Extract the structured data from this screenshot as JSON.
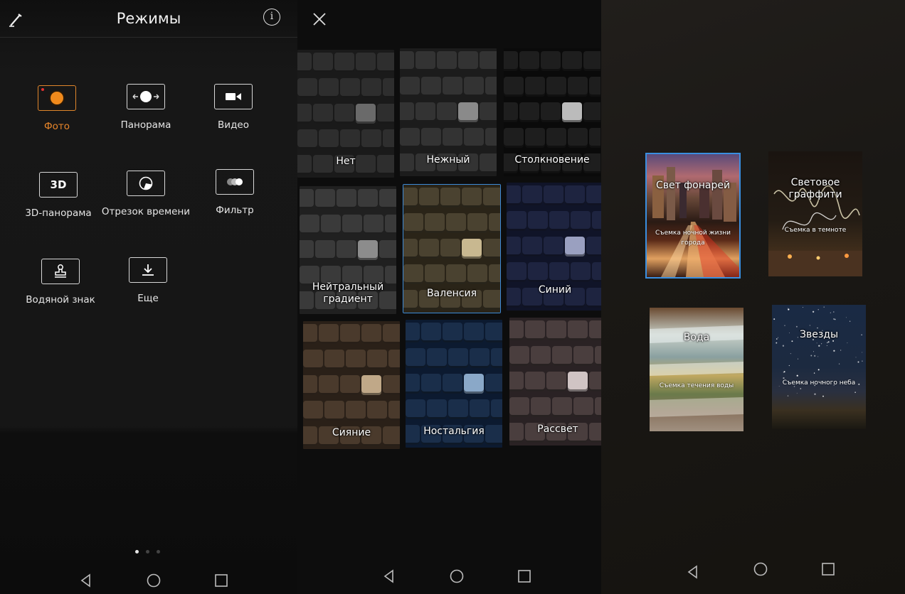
{
  "modes_screen": {
    "title": "Режимы",
    "icons": {
      "edit": "pencil-icon",
      "info": "info-icon"
    },
    "modes": [
      {
        "label": "Фото",
        "icon": "camera-record-icon",
        "active": true
      },
      {
        "label": "Панорама",
        "icon": "panorama-icon",
        "active": false
      },
      {
        "label": "Видео",
        "icon": "video-icon",
        "active": false
      },
      {
        "label": "3D-панорама",
        "icon": "3d-icon",
        "icon_text": "3D",
        "active": false
      },
      {
        "label": "Отрезок времени",
        "icon": "timelapse-icon",
        "active": false
      },
      {
        "label": "Фильтр",
        "icon": "filter-icon",
        "active": false
      },
      {
        "label": "Водяной знак",
        "icon": "watermark-stamp-icon",
        "active": false
      },
      {
        "label": "Еще",
        "icon": "download-icon",
        "active": false
      }
    ],
    "page_indicator": {
      "count": 3,
      "current": 1
    },
    "accent_color": "#e8862a"
  },
  "filters_screen": {
    "icons": {
      "close": "close-icon"
    },
    "filters": [
      {
        "label": "Нет"
      },
      {
        "label": "Нежный"
      },
      {
        "label": "Столкновение"
      },
      {
        "label": "Нейтральный градиент"
      },
      {
        "label": "Валенсия",
        "selected": true
      },
      {
        "label": "Синий"
      },
      {
        "label": "Сияние"
      },
      {
        "label": "Ностальгия"
      },
      {
        "label": "Рассвет"
      }
    ]
  },
  "night_modes_screen": {
    "cards": [
      {
        "title": "Свет фонарей",
        "subtitle": "Съемка ночной жизни города",
        "selected": true
      },
      {
        "title": "Световое граффити",
        "subtitle": "Съемка в темноте",
        "selected": false
      },
      {
        "title": "Вода",
        "subtitle": "Съемка течения воды",
        "selected": false
      },
      {
        "title": "Звезды",
        "subtitle": "Съемка ночного неба",
        "selected": false
      }
    ]
  },
  "navigation": {
    "back": "back-triangle-icon",
    "home": "home-circle-icon",
    "recent": "recent-square-icon"
  }
}
